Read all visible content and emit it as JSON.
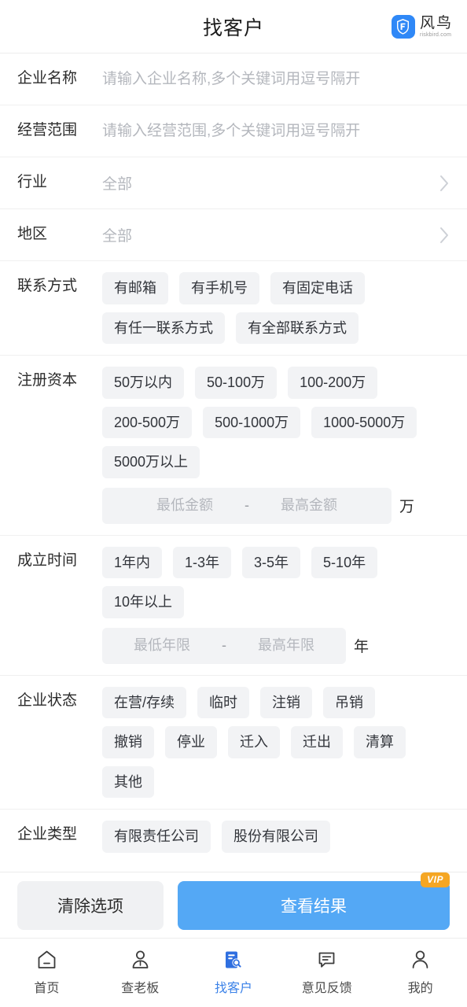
{
  "header": {
    "title": "找客户",
    "brand_name": "风鸟",
    "brand_domain": "riskbird.com",
    "brand_icon": "shield-icon"
  },
  "colors": {
    "accent": "#54a8f5",
    "accent_text": "#3b82e8",
    "tag_bg": "#f2f3f5",
    "vip_badge": "#f5a623",
    "placeholder": "#b4b7bd"
  },
  "form": {
    "company_name": {
      "label": "企业名称",
      "placeholder": "请输入企业名称,多个关键词用逗号隔开",
      "value": ""
    },
    "business_scope": {
      "label": "经营范围",
      "placeholder": "请输入经营范围,多个关键词用逗号隔开",
      "value": ""
    },
    "industry": {
      "label": "行业",
      "value": "全部",
      "chevron": "chevron-right-icon"
    },
    "region": {
      "label": "地区",
      "value": "全部",
      "chevron": "chevron-right-icon"
    },
    "contact": {
      "label": "联系方式",
      "tag_lines": [
        [
          "有邮箱",
          "有手机号",
          "有固定电话"
        ],
        [
          "有任一联系方式",
          "有全部联系方式"
        ]
      ]
    },
    "registered_capital": {
      "label": "注册资本",
      "tag_lines": [
        [
          "50万以内",
          "50-100万",
          "100-200万"
        ],
        [
          "200-500万",
          "500-1000万",
          "1000-5000万"
        ],
        [
          "5000万以上"
        ]
      ],
      "range": {
        "min_placeholder": "最低金额",
        "max_placeholder": "最高金额",
        "min_value": "",
        "max_value": "",
        "separator": "-",
        "unit": "万"
      }
    },
    "established": {
      "label": "成立时间",
      "tag_lines": [
        [
          "1年内",
          "1-3年",
          "3-5年",
          "5-10年"
        ],
        [
          "10年以上"
        ]
      ],
      "range": {
        "min_placeholder": "最低年限",
        "max_placeholder": "最高年限",
        "min_value": "",
        "max_value": "",
        "separator": "-",
        "unit": "年"
      }
    },
    "company_status": {
      "label": "企业状态",
      "tag_lines": [
        [
          "在营/存续",
          "临时",
          "注销",
          "吊销"
        ],
        [
          "撤销",
          "停业",
          "迁入",
          "迁出",
          "清算"
        ],
        [
          "其他"
        ]
      ]
    },
    "company_type": {
      "label": "企业类型",
      "tag_lines": [
        [
          "有限责任公司",
          "股份有限公司"
        ]
      ]
    }
  },
  "actions": {
    "clear_label": "清除选项",
    "submit_label": "查看结果",
    "vip_badge": "VIP"
  },
  "tabbar": {
    "items": [
      {
        "label": "首页",
        "icon": "home-icon",
        "active": false
      },
      {
        "label": "查老板",
        "icon": "person-search-icon",
        "active": false
      },
      {
        "label": "找客户",
        "icon": "document-search-icon",
        "active": true
      },
      {
        "label": "意见反馈",
        "icon": "feedback-icon",
        "active": false
      },
      {
        "label": "我的",
        "icon": "user-icon",
        "active": false
      }
    ]
  }
}
